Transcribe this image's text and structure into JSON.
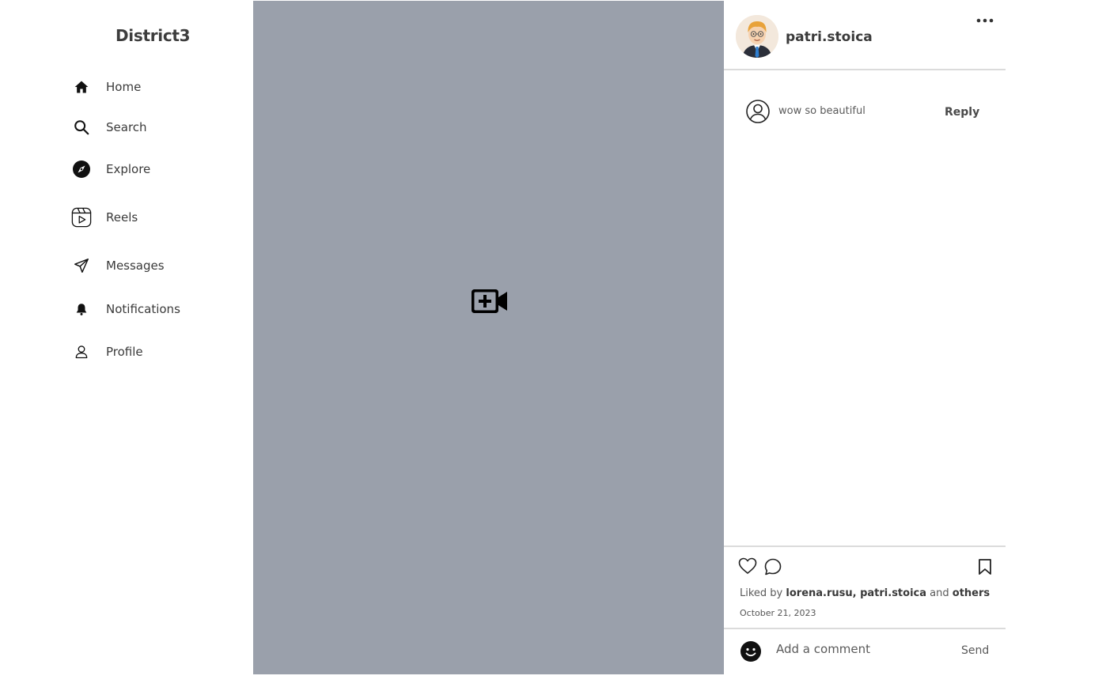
{
  "app": {
    "brand": "District3"
  },
  "sidebar": {
    "items": [
      {
        "label": "Home",
        "icon": "home-icon"
      },
      {
        "label": "Search",
        "icon": "search-icon"
      },
      {
        "label": "Explore",
        "icon": "compass-icon"
      },
      {
        "label": "Reels",
        "icon": "reels-icon"
      },
      {
        "label": "Messages",
        "icon": "paper-plane-icon"
      },
      {
        "label": "Notifications",
        "icon": "bell-icon"
      },
      {
        "label": "Profile",
        "icon": "user-icon"
      }
    ]
  },
  "media": {
    "icon": "video-plus-icon",
    "background": "#9aa0ab"
  },
  "post": {
    "username": "patri.stoica",
    "comments": [
      {
        "text": "wow so beautiful",
        "reply_label": "Reply"
      }
    ],
    "liked_prefix": "Liked by",
    "liked_users": "lorena.rusu, patri.stoica",
    "liked_and": "and",
    "liked_others": "others",
    "date": "October 21, 2023",
    "composer": {
      "placeholder": "Add a comment",
      "send_label": "Send"
    }
  }
}
